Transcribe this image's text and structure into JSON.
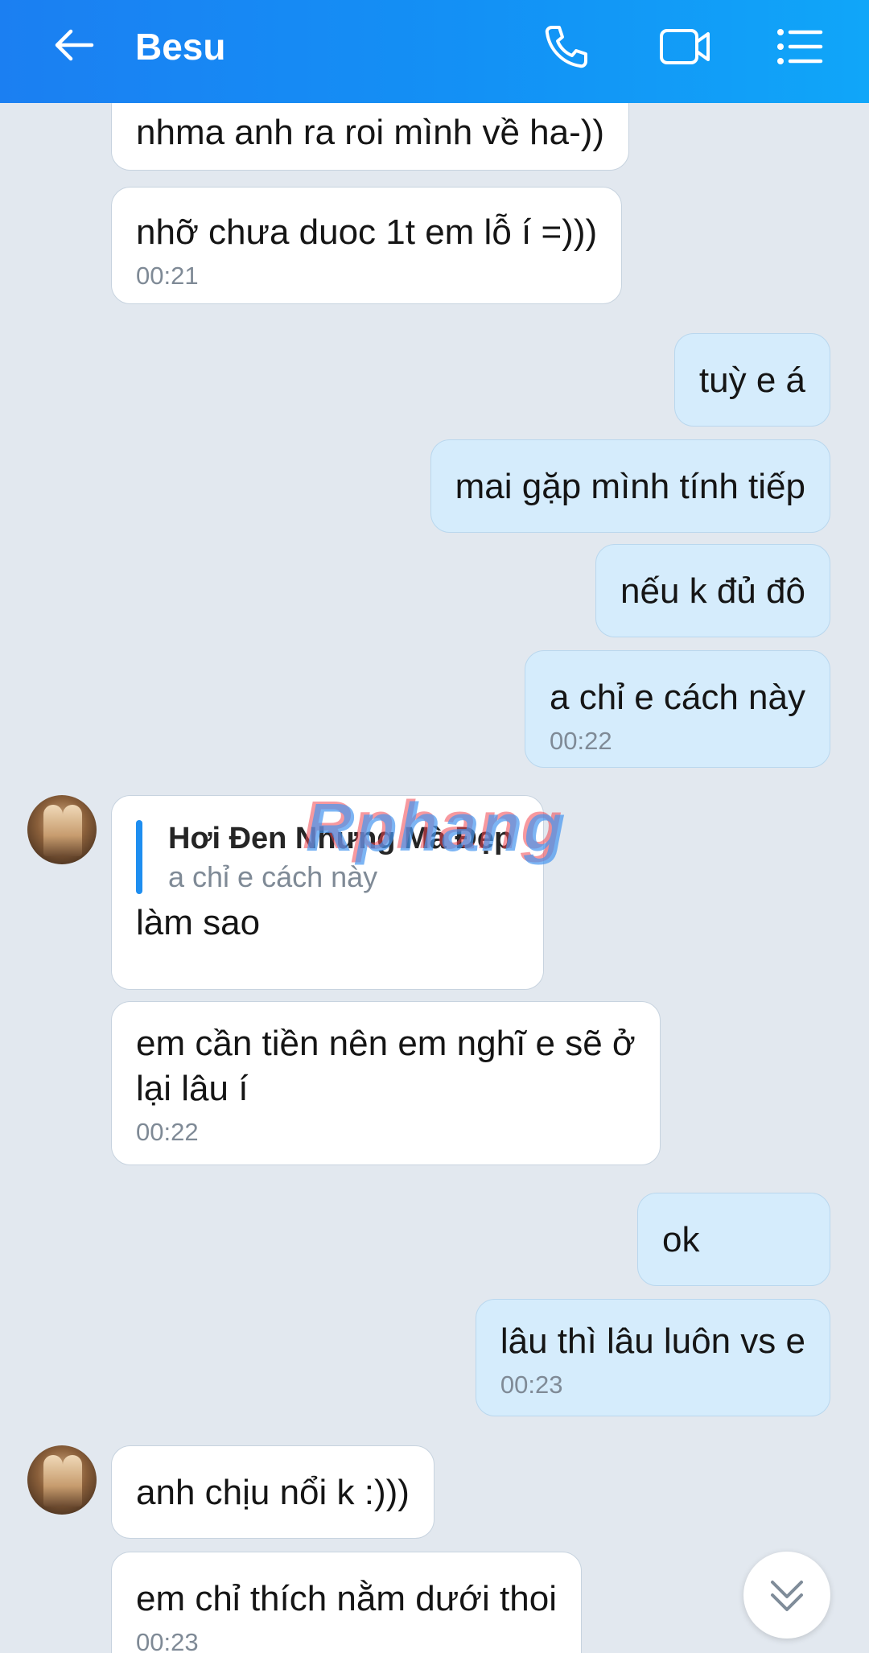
{
  "header": {
    "title": "Besu",
    "icons": [
      "back-arrow-icon",
      "phone-icon",
      "video-call-icon",
      "menu-list-icon"
    ]
  },
  "messages": [
    {
      "dir": "in",
      "text": "nhma anh ra roi mình về ha-))"
    },
    {
      "dir": "in",
      "text": "nhỡ chưa duoc 1t em lỗ í =)))",
      "time": "00:21"
    },
    {
      "dir": "out",
      "text": "tuỳ e á"
    },
    {
      "dir": "out",
      "text": "mai gặp mình tính tiếp"
    },
    {
      "dir": "out",
      "text": "nếu k đủ đô"
    },
    {
      "dir": "out",
      "text": "a chỉ e cách này",
      "time": "00:22"
    },
    {
      "dir": "in",
      "reply_name": "Hơi Đen Nhưng Mà Đẹp",
      "reply_text": "a chỉ e cách này",
      "text": "làm sao"
    },
    {
      "dir": "in",
      "text_line1": "em cần tiền nên em nghĩ e sẽ ở",
      "text_line2": "lại lâu í",
      "time": "00:22"
    },
    {
      "dir": "out",
      "text": "ok"
    },
    {
      "dir": "out",
      "text": "lâu thì lâu luôn vs e",
      "time": "00:23"
    },
    {
      "dir": "in",
      "text": "anh chịu nổi k :)))"
    },
    {
      "dir": "in",
      "text": "em chỉ thích nằm dưới thoi",
      "time": "00:23"
    }
  ],
  "watermark": "Rphang",
  "colors": {
    "header_start": "#1b7ff2",
    "header_end": "#10a6f9",
    "chat_bg": "#e2e8ef",
    "incoming_bubble": "#ffffff",
    "outgoing_bubble": "#d5ecfc",
    "quote_bar": "#1e8ef0"
  },
  "scroll_button_icon": "double-chevron-down-icon"
}
